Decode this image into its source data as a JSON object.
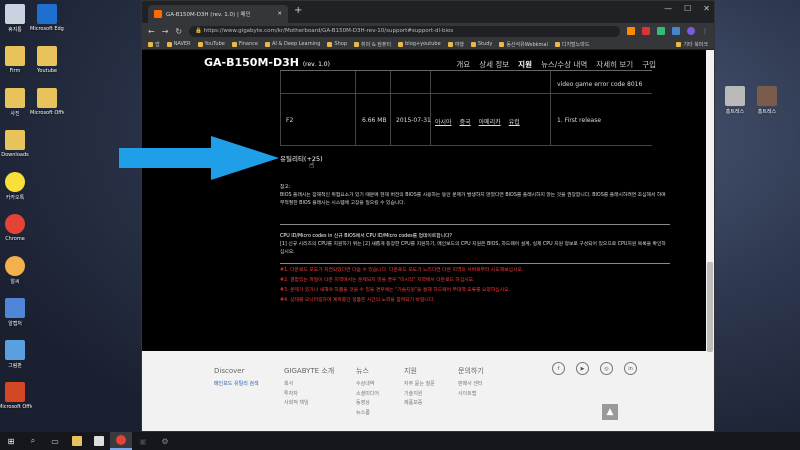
{
  "desktop": {
    "left_icons": [
      {
        "label": "휴지통",
        "icon": "recycle-bin-icon",
        "color": "#c9d3e0"
      },
      {
        "label": "Microsoft Edge",
        "icon": "edge-icon",
        "color": "#1f6fd1"
      },
      {
        "label": "Firm",
        "icon": "folder-icon",
        "color": "#e8c25a"
      },
      {
        "label": "Youtube",
        "icon": "folder-icon",
        "color": "#e8c25a"
      },
      {
        "label": "사진",
        "icon": "folder-icon",
        "color": "#e8c25a"
      },
      {
        "label": "Microsoft Office",
        "icon": "folder-icon",
        "color": "#e8c25a"
      },
      {
        "label": "Downloads",
        "icon": "folder-icon",
        "color": "#e8c25a"
      },
      {
        "label": "카카오톡",
        "icon": "kakaotalk-icon",
        "color": "#f7e03a"
      },
      {
        "label": "Chrome",
        "icon": "chrome-icon",
        "color": "#e54335"
      },
      {
        "label": "알씨",
        "icon": "alsee-icon",
        "color": "#f3b04b"
      },
      {
        "label": "알캡처",
        "icon": "alcapture-icon",
        "color": "#4f86d9"
      },
      {
        "label": "그림판",
        "icon": "paint-icon",
        "color": "#5aa0e0"
      },
      {
        "label": "Microsoft Office Po...",
        "icon": "powerpoint-icon",
        "color": "#d24726"
      }
    ],
    "right_icons": [
      {
        "label": "홈트레스",
        "icon": "photo-folder-icon",
        "color": "#b9b9b9"
      },
      {
        "label": "홈트레스",
        "icon": "photo-folder-icon",
        "color": "#7b5b4a"
      }
    ]
  },
  "browser": {
    "tab_title": "GA-B150M-D3H (rev. 1.0) | 메인",
    "new_tab": "+",
    "window_controls": [
      "—",
      "☐",
      "✕"
    ],
    "url": "https://www.gigabyte.com/kr/Motherboard/GA-B150M-D3H-rev-10/support#support-dl-bios",
    "bookmarks": [
      "앱",
      "NAVER",
      "YouTube",
      "Finance",
      "AI & Deep Learning",
      "Shop",
      "취미 & 컴퓨터",
      "blog+youtube",
      "여행",
      "Study",
      "동산석유Webkmal",
      "디지털노마드",
      "기타 북마크"
    ]
  },
  "page": {
    "product_name": "GA-B150M-D3H",
    "product_rev": "(rev. 1.0)",
    "nav": [
      "개요",
      "상세 정보",
      "지원",
      "뉴스/수상 내역",
      "자세히 보기",
      "구입"
    ],
    "nav_active": "지원",
    "top_note": "video game error code 8016",
    "row": {
      "version": "F2",
      "size": "6.66 MB",
      "date": "2015-07-31",
      "mirrors": [
        "아시아",
        "중국",
        "아메리카",
        "유럽"
      ],
      "description": "1. First release"
    },
    "utility_link": "유틸리티(+25)",
    "notes": {
      "heading1": "참고:",
      "text1": "BIOS 플래시는 잠재적인 위험요소가 있기 때문에 현재 버전의 BIOS를 사용하는 동안 문제가 발생하지 않았다면 BIOS를 플래시하지 않는 것을 권장합니다. BIOS를 플래시하려면 조심해서 하며 부적절한 BIOS 플래시는 시스템에 고장을 일으킬 수 있습니다.",
      "heading2": "CPU ID/Micro codes in 신규 BIOS에서 CPU ID/Micro codes를 업데이트합니다?",
      "text2": "[1] 신규 시리즈의 CPU를 지원하기 위는 [2] 새롭게 등장한 CPU를 지원하기, 메인보드의 CPU 지원은 BIOS, 하드웨어 설계, 실제 CPU 지원 정보로 구성되어 있으므로 CPU지원 목록을 확인하십시오.",
      "red": [
        "#1. 다운로드 포도가 지연되었다면 다음 수 있습니다. 다운로드 포도가 느리다면 다른 지역의 서버로부터 시도해보십시오.",
        "#2. 결함있는 파일이 다운 지역에서는 문제되지 않을 경우 \"미시작\" 지역에서 다운로드 하십시오.",
        "#3. 문제가 있거나 새해야 하품을 것을 수 있을 경우에는 \"기술지원\"을 통해 하드웨어 부대역 오류를 요청하십시오.",
        "#4. 상태를 모니터링하여 계획중인 정품은 시간의 노력을 참여되기 바랍니다."
      ]
    }
  },
  "footer": {
    "columns": [
      {
        "heading": "Discover",
        "items": [
          "메인보드 유틸리 검색"
        ]
      },
      {
        "heading": "GIGABYTE 소개",
        "items": [
          "회사",
          "투자자",
          "사회적 책임"
        ]
      },
      {
        "heading": "뉴스",
        "items": [
          "수상내역",
          "소셜미디어",
          "동영상",
          "뉴스룸"
        ]
      },
      {
        "heading": "지원",
        "items": [
          "자주 묻는 질문",
          "기술지원",
          "제품보증"
        ]
      },
      {
        "heading": "문의하기",
        "items": [
          "판매사 센터",
          "사이트맵"
        ]
      }
    ],
    "social": [
      "f",
      "▶",
      "◎",
      "in"
    ],
    "to_top": "▲"
  },
  "taskbar": {
    "items": [
      "start-icon",
      "search-icon",
      "task-view-icon",
      "explorer-icon",
      "photos-icon",
      "chrome-icon",
      "terminal-icon",
      "settings-icon"
    ]
  },
  "colors": {
    "accent_arrow": "#1f9fe8",
    "red_text": "#ff3b3b",
    "link_blue": "#1e5fbf"
  }
}
